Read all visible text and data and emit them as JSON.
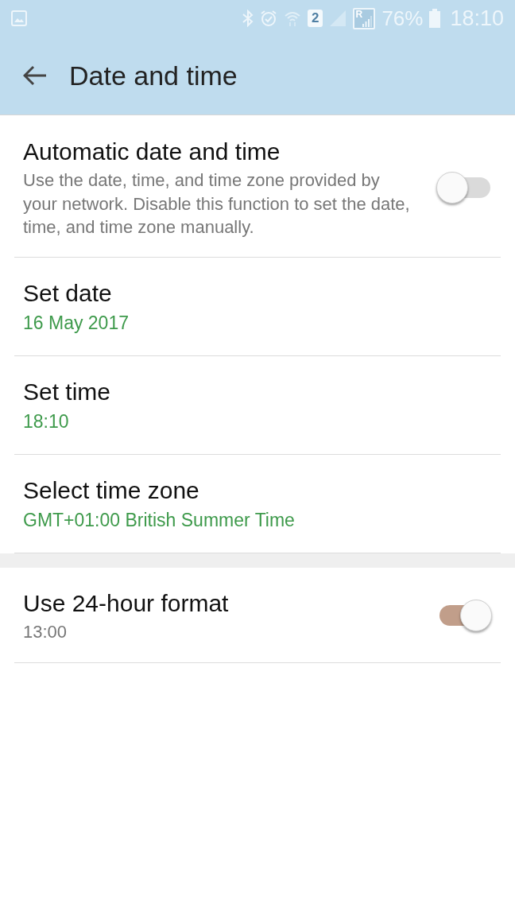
{
  "status_bar": {
    "sim_slot": "2",
    "roaming_label": "R",
    "battery": "76%",
    "time": "18:10"
  },
  "app_bar": {
    "title": "Date and time"
  },
  "sections": [
    {
      "items": [
        {
          "kind": "switch",
          "title": "Automatic date and time",
          "summary": "Use the date, time, and time zone provided by your network. Disable this function to set the date, time, and time zone manually.",
          "on": false
        },
        {
          "kind": "value",
          "title": "Set date",
          "value": "16 May 2017"
        },
        {
          "kind": "value",
          "title": "Set time",
          "value": "18:10"
        },
        {
          "kind": "value",
          "title": "Select time zone",
          "value": "GMT+01:00 British Summer Time"
        }
      ]
    },
    {
      "items": [
        {
          "kind": "switch",
          "title": "Use 24-hour format",
          "summary": "13:00",
          "on": true
        }
      ]
    }
  ]
}
